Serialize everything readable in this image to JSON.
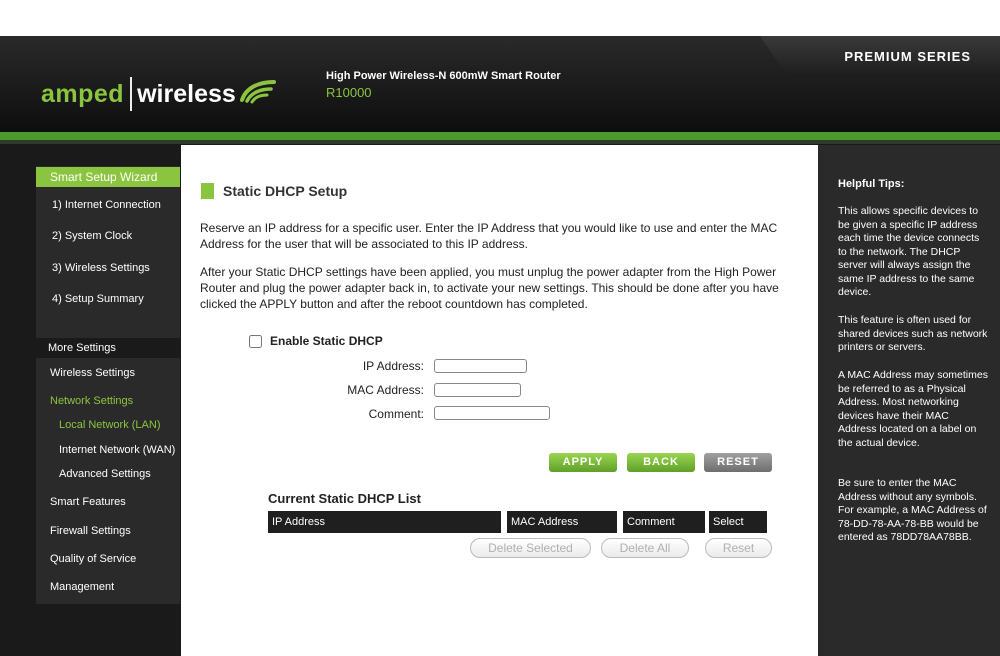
{
  "header": {
    "brand_part1": "amped",
    "brand_part2": "wireless",
    "premium_label": "PREMIUM SERIES",
    "product_name": "High Power Wireless-N 600mW Smart Router",
    "product_model": "R10000",
    "brand_color": "#8bc53f"
  },
  "sidebar": {
    "wizard_title": "Smart Setup Wizard",
    "wizard_steps": [
      "1) Internet Connection",
      "2) System Clock",
      "3) Wireless Settings",
      "4) Setup Summary"
    ],
    "more_title": "More Settings",
    "items": [
      "Wireless Settings",
      "Network Settings",
      "Local Network (LAN)",
      "Internet Network (WAN)",
      "Advanced Settings",
      "Smart Features",
      "Firewall Settings",
      "Quality of Service",
      "Management"
    ]
  },
  "main": {
    "title": "Static DHCP Setup",
    "para1": "Reserve an IP address for a specific user. Enter the IP Address that you would like to use and enter the MAC Address for the user that will be associated to this IP address.",
    "para2": "After your Static DHCP settings have been applied, you must unplug the power adapter from the High Power Router and plug the power adapter back in, to activate your new settings. This should be done after you have clicked the APPLY button and after the reboot countdown has completed.",
    "enable_label": "Enable Static DHCP",
    "ip_label": "IP Address:",
    "mac_label": "MAC Address:",
    "comment_label": "Comment:",
    "ip_value": "",
    "mac_value": "",
    "comment_value": "",
    "apply_label": "APPLY",
    "back_label": "BACK",
    "reset_label": "RESET",
    "list_title": "Current Static DHCP List",
    "columns": [
      "IP Address",
      "MAC Address",
      "Comment",
      "Select"
    ],
    "delete_selected_label": "Delete Selected",
    "delete_all_label": "Delete All",
    "reset_list_label": "Reset"
  },
  "tips": {
    "title": "Helpful Tips:",
    "tip1": "This allows specific devices to be given a specific IP address each time the device connects to the network.  The DHCP server will always assign the same IP address to the same device.",
    "tip2": "This feature is often used for shared devices such as network printers or servers.",
    "tip3": "A MAC Address may sometimes be referred to as a Physical Address.  Most networking devices have their MAC Address located on a label on the actual device.",
    "tip4": "Be sure to enter the MAC Address without any symbols.  For example, a MAC Address of 78-DD-78-AA-78-BB  would be entered as 78DD78AA78BB."
  }
}
